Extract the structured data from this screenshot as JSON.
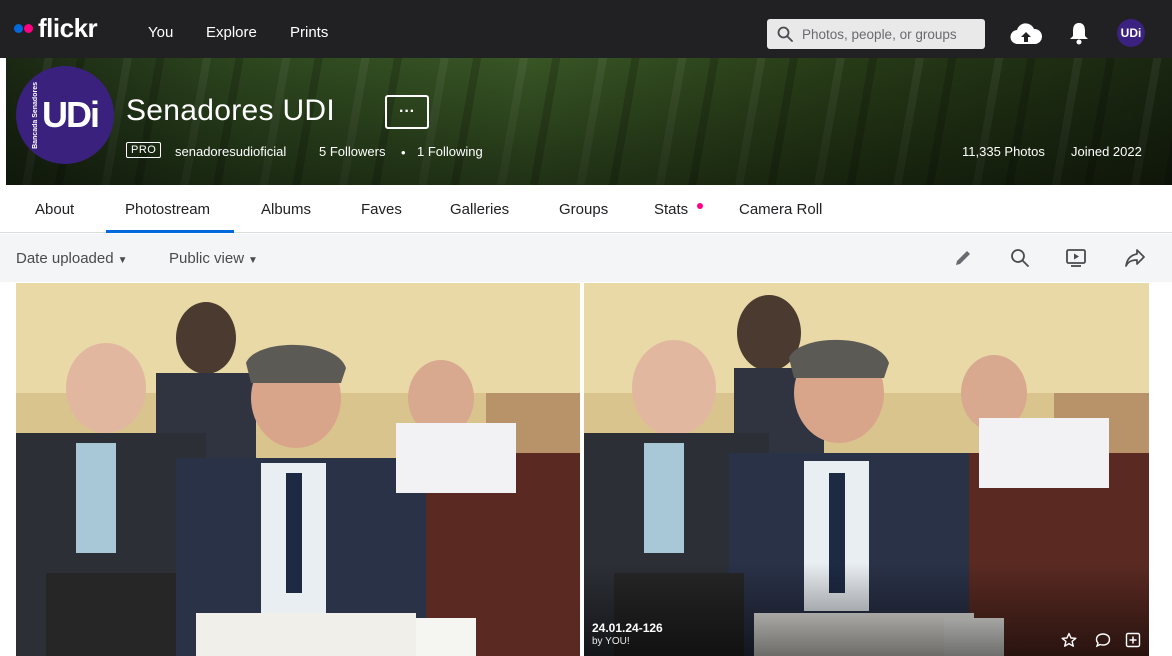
{
  "nav": {
    "logo_text": "flickr",
    "links": [
      "You",
      "Explore",
      "Prints"
    ],
    "search_placeholder": "Photos, people, or groups",
    "user_initials": "UDi"
  },
  "profile": {
    "name": "Senadores UDI",
    "more_label": "···",
    "avatar_text": "UDi",
    "avatar_side_text": "Bancada Senadores",
    "badge": "PRO",
    "username": "senadoresudioficial",
    "followers": "5 Followers",
    "separator": "•",
    "following": "1 Following",
    "photos_count": "11,335 Photos",
    "joined": "Joined 2022"
  },
  "tabs": [
    "About",
    "Photostream",
    "Albums",
    "Faves",
    "Galleries",
    "Groups",
    "Stats",
    "Camera Roll"
  ],
  "active_tab": "Photostream",
  "toolbar": {
    "sort_label": "Date uploaded",
    "view_label": "Public view",
    "icons": [
      "pencil-icon",
      "search-icon",
      "slideshow-icon",
      "share-icon"
    ]
  },
  "photos": [
    {
      "title": "",
      "author": ""
    },
    {
      "title": "24.01.24-126",
      "author": "by YOU!"
    }
  ],
  "colors": {
    "topbar": "#212124",
    "accent_blue": "#006add",
    "accent_pink": "#ff0084",
    "avatar_purple": "#3a217d",
    "toolbar_bg": "#f3f5f6"
  }
}
